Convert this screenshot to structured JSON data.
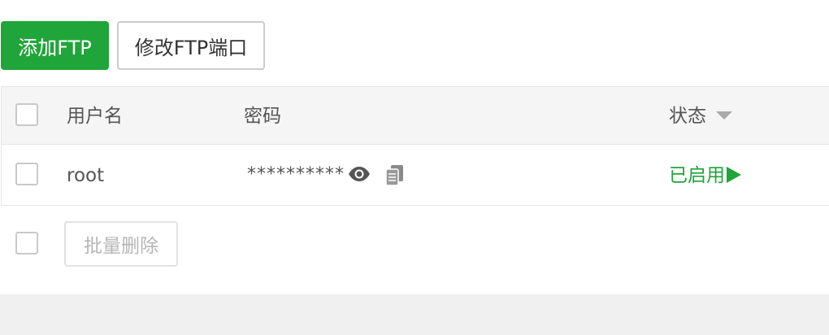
{
  "toolbar": {
    "add_ftp_label": "添加FTP",
    "edit_port_label": "修改FTP端口"
  },
  "table": {
    "columns": {
      "username": "用户名",
      "password": "密码",
      "status": "状态"
    },
    "rows": [
      {
        "username": "root",
        "password_masked": "**********",
        "status": "已启用"
      }
    ]
  },
  "footer": {
    "batch_delete_label": "批量删除"
  },
  "colors": {
    "accent": "#20a53a",
    "header_bg": "#f5f5f5",
    "footer_band": "#f0f0f0"
  },
  "icons": {
    "show_password": "eye-icon",
    "copy_password": "copy-icon",
    "sort": "caret-down-icon",
    "status_toggle": "play-icon"
  }
}
